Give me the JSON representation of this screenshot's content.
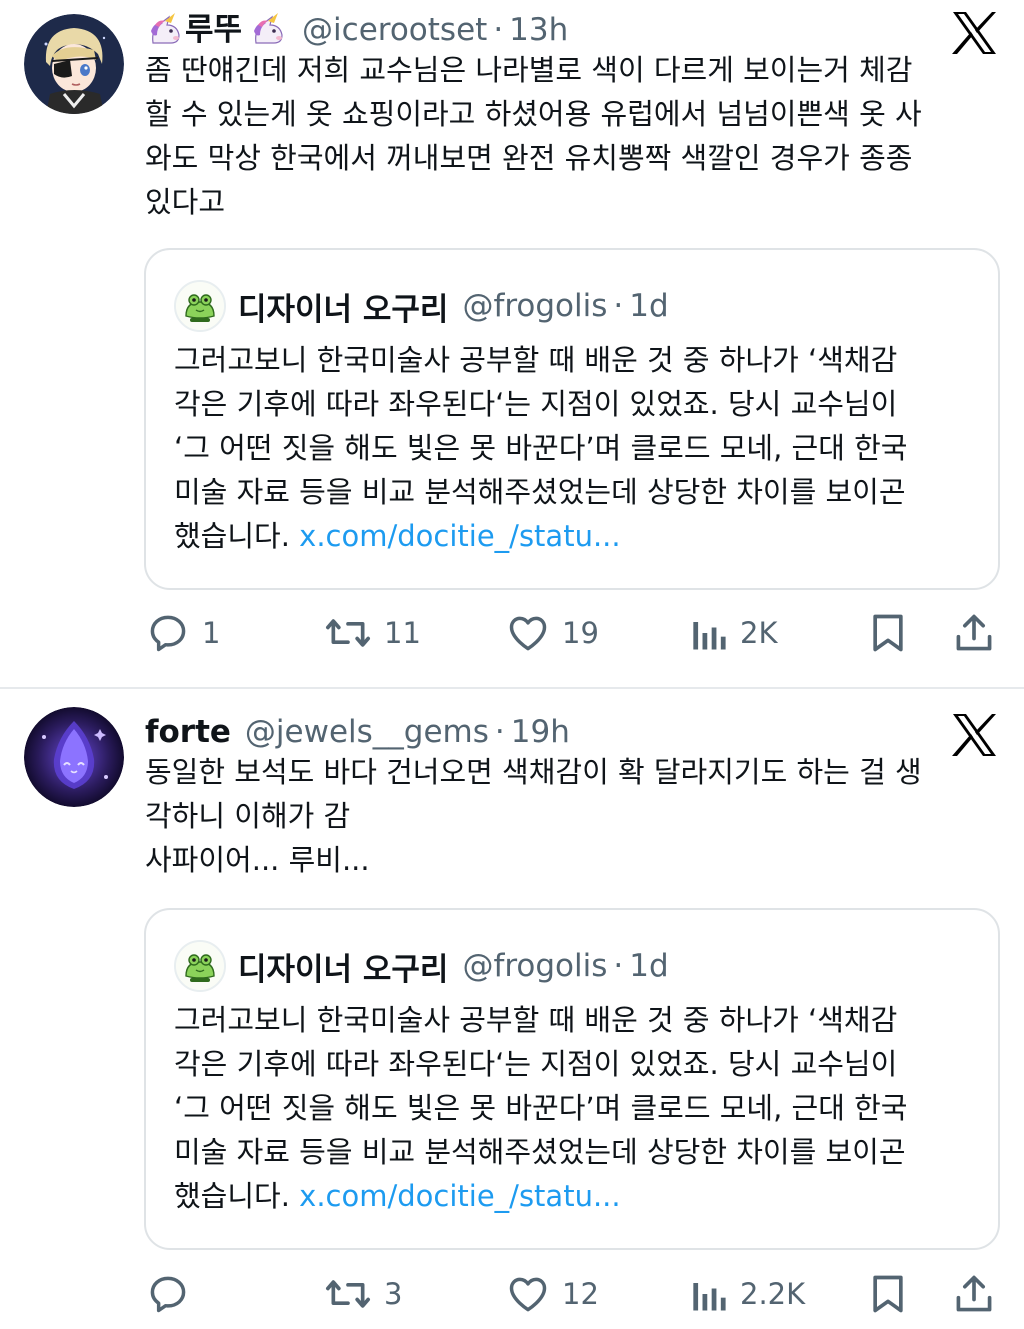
{
  "tweets": [
    {
      "author_name": "루뚜",
      "name_prefix_emoji": "unicorn-emoji",
      "name_suffix_emoji": "unicorn-emoji",
      "handle": "@icerootset",
      "dot": "·",
      "time": "13h",
      "text": "좀 딴얘긴데 저희 교수님은 나라별로 색이 다르게 보이는거 체감\n할 수 있는게 옷 쇼핑이라고 하셨어용 유럽에서 넘넘이쁜색 옷 사\n와도 막상 한국에서 꺼내보면 완전 유치뽕짝 색깔인 경우가 종종\n있다고",
      "quote": {
        "author_name": "디자이너 오구리",
        "handle": "@frogolis",
        "dot": "·",
        "time": "1d",
        "text_lines": [
          "그러고보니 한국미술사 공부할 때 배운 것 중 하나가 ‘색채감",
          "각은 기후에 따라 좌우된다‘는 지점이 있었죠. 당시 교수님이",
          "‘그 어떤 짓을 해도 빛은 못 바꾼다’며 클로드 모네, 근대 한국",
          "미술 자료 등을 비교 분석해주셨었는데 상당한 차이를 보이곤"
        ],
        "last_line_prefix": "했습니다. ",
        "link": "x.com/docitie_/statu..."
      },
      "actions": {
        "replies": "1",
        "retweets": "11",
        "likes": "19",
        "views": "2K"
      }
    },
    {
      "author_name": "forte",
      "handle": "@jewels__gems",
      "dot": "·",
      "time": "19h",
      "text": "동일한 보석도 바다 건너오면 색채감이 확 달라지기도 하는 걸 생\n각하니 이해가 감\n사파이어... 루비...",
      "quote": {
        "author_name": "디자이너 오구리",
        "handle": "@frogolis",
        "dot": "·",
        "time": "1d",
        "text_lines": [
          "그러고보니 한국미술사 공부할 때 배운 것 중 하나가 ‘색채감",
          "각은 기후에 따라 좌우된다‘는 지점이 있었죠. 당시 교수님이",
          "‘그 어떤 짓을 해도 빛은 못 바꾼다’며 클로드 모네, 근대 한국",
          "미술 자료 등을 비교 분석해주셨었는데 상당한 차이를 보이곤"
        ],
        "last_line_prefix": "했습니다. ",
        "link": "x.com/docitie_/statu..."
      },
      "actions": {
        "replies": "",
        "retweets": "3",
        "likes": "12",
        "views": "2.2K"
      }
    }
  ],
  "colors": {
    "text": "#0f1419",
    "secondary": "#536471",
    "link": "#1d9bf0",
    "border": "#dfe3e6"
  }
}
